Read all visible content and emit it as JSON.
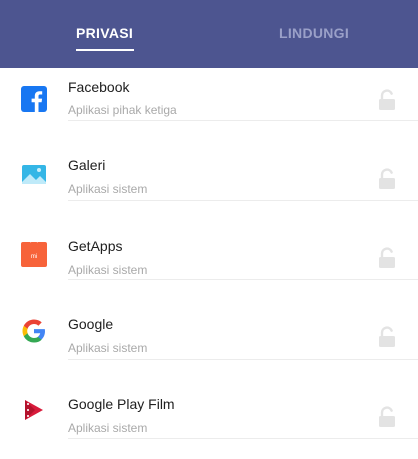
{
  "tabs": {
    "privasi": "PRIVASI",
    "lindungi": "LINDUNGI"
  },
  "apps": [
    {
      "name": "Facebook",
      "type": "Aplikasi pihak ketiga",
      "icon": "facebook-icon"
    },
    {
      "name": "Galeri",
      "type": "Aplikasi sistem",
      "icon": "gallery-icon"
    },
    {
      "name": "GetApps",
      "type": "Aplikasi sistem",
      "icon": "getapps-icon"
    },
    {
      "name": "Google",
      "type": "Aplikasi sistem",
      "icon": "google-icon"
    },
    {
      "name": "Google Play Film",
      "type": "Aplikasi sistem",
      "icon": "play-film-icon"
    }
  ],
  "colors": {
    "header": "#4d5590",
    "active_tab": "#ffffff",
    "inactive_tab": "#9aa0c8"
  },
  "getapps_badge": "mi"
}
